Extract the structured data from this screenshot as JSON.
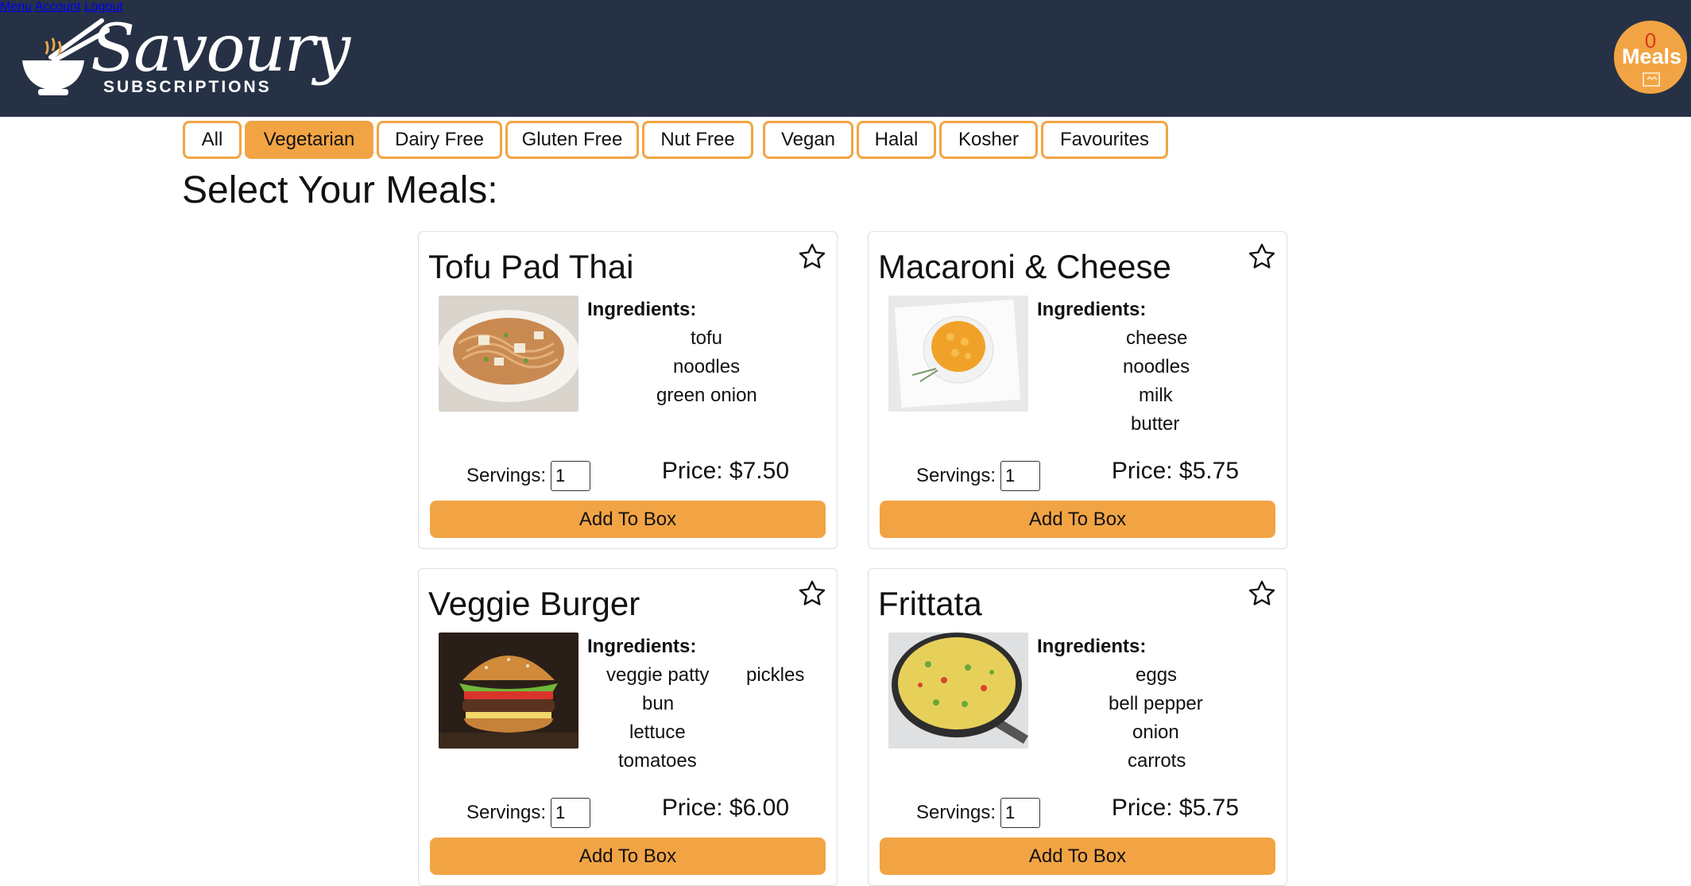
{
  "brand": {
    "script": "Savoury",
    "sub": "SUBSCRIPTIONS"
  },
  "nav": {
    "menu": "Menu",
    "account": "Account",
    "logout": "Logout"
  },
  "cart": {
    "count": "0",
    "label": "Meals"
  },
  "filters": [
    "All",
    "Vegetarian",
    "Dairy Free",
    "Gluten Free",
    "Nut Free",
    "Vegan",
    "Halal",
    "Kosher",
    "Favourites"
  ],
  "active_filter": "Vegetarian",
  "page_title": "Select Your Meals:",
  "ingredients_label": "Ingredients:",
  "servings_label": "Servings:",
  "add_label": "Add To Box",
  "meals": [
    {
      "name": "Tofu Pad Thai",
      "ingredients": [
        "tofu",
        "noodles",
        "green onion"
      ],
      "servings": "1",
      "price": "Price: $7.50"
    },
    {
      "name": "Macaroni & Cheese",
      "ingredients": [
        "cheese",
        "noodles",
        "milk",
        "butter"
      ],
      "servings": "1",
      "price": "Price: $5.75"
    },
    {
      "name": "Veggie Burger",
      "ingredients": [
        "veggie patty",
        "bun",
        "lettuce",
        "tomatoes",
        "pickles"
      ],
      "servings": "1",
      "price": "Price: $6.00"
    },
    {
      "name": "Frittata",
      "ingredients": [
        "eggs",
        "bell pepper",
        "onion",
        "carrots"
      ],
      "servings": "1",
      "price": "Price: $5.75"
    }
  ],
  "colors": {
    "header": "#263145",
    "accent": "#f2a444",
    "cart_count": "#d63a1a"
  }
}
